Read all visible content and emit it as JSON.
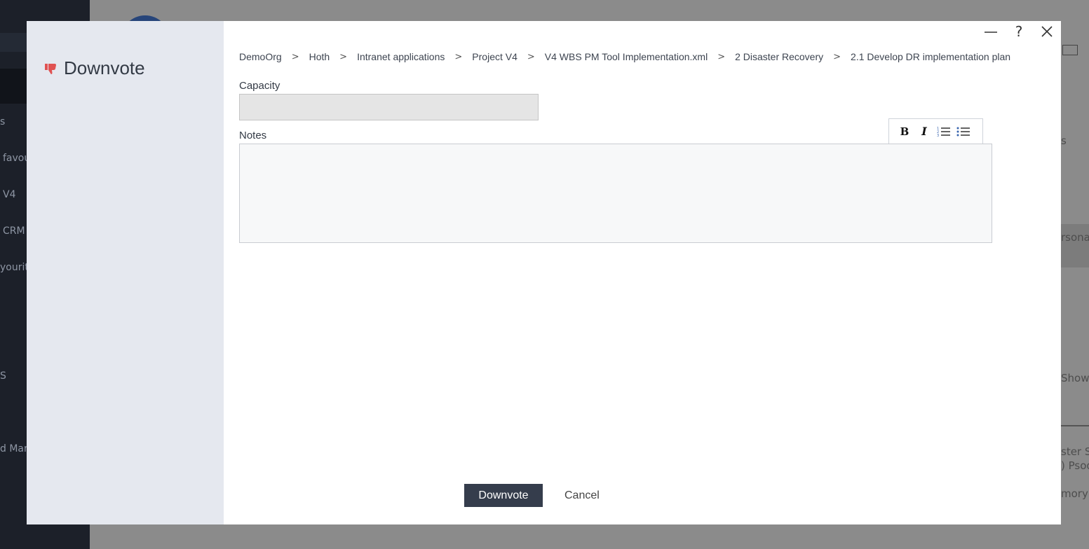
{
  "background": {
    "sidebar_items": [
      {
        "label": "s",
        "red": false
      },
      {
        "label": "favour",
        "red": false
      },
      {
        "label": "V4",
        "red": false
      },
      {
        "label": "CRM",
        "red": false
      },
      {
        "label": "yourite",
        "red": false
      },
      {
        "label": "S",
        "red": false
      },
      {
        "label": "",
        "red": true
      },
      {
        "label": "d Mark",
        "red": false
      }
    ],
    "right_texts": [
      "s",
      "rsona",
      "Show",
      "ster Su",
      ") Psod",
      "mory"
    ]
  },
  "modal": {
    "title": "Downvote",
    "title_icon": "thumbs-down-icon",
    "accent_color": "#e05252",
    "breadcrumb": [
      "DemoOrg",
      "Hoth",
      "Intranet applications",
      "Project V4",
      "V4 WBS PM Tool Implementation.xml",
      "2 Disaster Recovery",
      "2.1 Develop DR implementation plan"
    ],
    "capacity": {
      "label": "Capacity",
      "value": ""
    },
    "notes": {
      "label": "Notes",
      "value": ""
    },
    "toolbar": [
      "bold-icon",
      "italic-icon",
      "ordered-list-icon",
      "bullet-list-icon"
    ],
    "submit_label": "Downvote",
    "cancel_label": "Cancel",
    "window_controls": [
      "minimize-icon",
      "help-icon",
      "close-icon"
    ]
  }
}
